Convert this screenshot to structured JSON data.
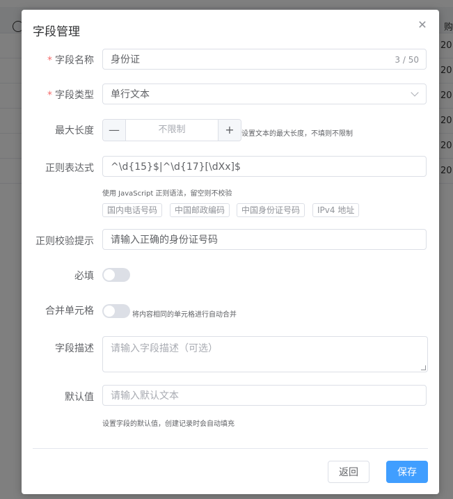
{
  "background": {
    "header_partial": "购",
    "row_values": [
      "20",
      "20",
      "20",
      "20",
      "20",
      "20"
    ]
  },
  "dialog": {
    "title": "字段管理",
    "close_icon": "close-icon",
    "fields": {
      "name": {
        "label": "字段名称",
        "required_mark": "*",
        "value": "身份证",
        "count": "3 / 50"
      },
      "type": {
        "label": "字段类型",
        "required_mark": "*",
        "value": "单行文本"
      },
      "max_length": {
        "label": "最大长度",
        "minus": "—",
        "plus": "+",
        "value": "不限制",
        "hint": "设置文本的最大长度，不填则不限制"
      },
      "regex": {
        "label": "正则表达式",
        "value": "^\\d{15}$|^\\d{17}[\\dXx]$",
        "hint": "使用 JavaScript 正则语法，留空则不校验",
        "tags": [
          "国内电话号码",
          "中国邮政编码",
          "中国身份证号码",
          "IPv4 地址"
        ]
      },
      "regex_hint": {
        "label": "正则校验提示",
        "value": "请输入正确的身份证号码"
      },
      "required": {
        "label": "必填",
        "on": false
      },
      "merge_cells": {
        "label": "合并单元格",
        "on": false,
        "hint": "将内容相同的单元格进行自动合并"
      },
      "description": {
        "label": "字段描述",
        "placeholder": "请输入字段描述（可选）"
      },
      "default_value": {
        "label": "默认值",
        "placeholder": "请输入默认文本",
        "hint": "设置字段的默认值，创建记录时会自动填充"
      }
    },
    "buttons": {
      "back": "返回",
      "save": "保存"
    }
  }
}
